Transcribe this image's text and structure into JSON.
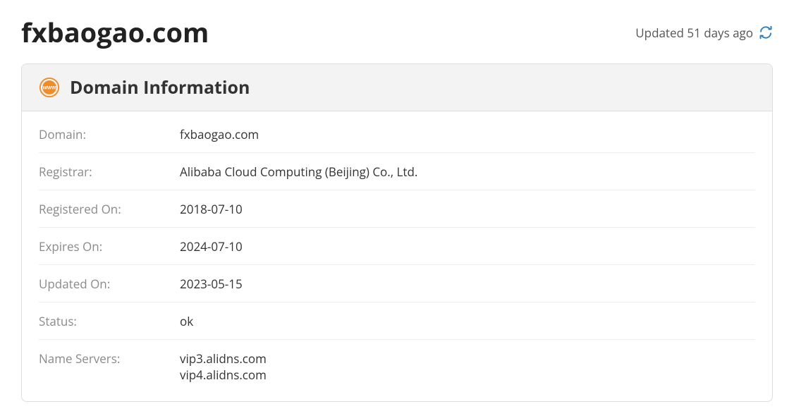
{
  "header": {
    "title": "fxbaogao.com",
    "updated_text": "Updated 51 days ago"
  },
  "panel": {
    "title": "Domain Information"
  },
  "info": {
    "rows": [
      {
        "label": "Domain:",
        "value": "fxbaogao.com"
      },
      {
        "label": "Registrar:",
        "value": "Alibaba Cloud Computing (Beijing) Co., Ltd."
      },
      {
        "label": "Registered On:",
        "value": "2018-07-10"
      },
      {
        "label": "Expires On:",
        "value": "2024-07-10"
      },
      {
        "label": "Updated On:",
        "value": "2023-05-15"
      },
      {
        "label": "Status:",
        "value": "ok"
      },
      {
        "label": "Name Servers:",
        "value": "vip3.alidns.com\nvip4.alidns.com"
      }
    ]
  }
}
